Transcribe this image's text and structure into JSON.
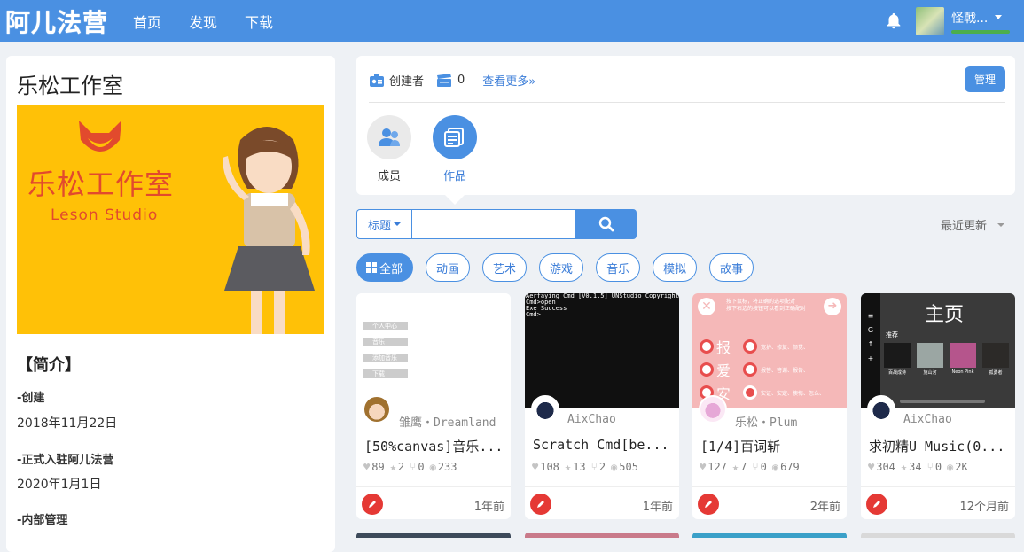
{
  "header": {
    "logo_text": "阿儿法营",
    "nav": [
      "首页",
      "发现",
      "下载"
    ],
    "username": "怪戟...",
    "bell_icon": "bell-icon"
  },
  "studio": {
    "title": "乐松工作室",
    "banner_cn": "乐松工作室",
    "banner_en": "Leson Studio",
    "intro_heading": "【简介】",
    "info": [
      {
        "label": "-创建",
        "value": "2018年11月22日"
      },
      {
        "label": "-正式入驻阿儿法营",
        "value": "2020年1月1日"
      },
      {
        "label": "-内部管理",
        "value": ""
      }
    ]
  },
  "creator_bar": {
    "creator_label": "创建者",
    "count": "0",
    "see_more": "查看更多»",
    "manage": "管理"
  },
  "tabs": [
    {
      "label": "成员",
      "icon": "members-icon"
    },
    {
      "label": "作品",
      "icon": "works-icon"
    }
  ],
  "search": {
    "select_label": "标题",
    "placeholder": "",
    "sort_label": "最近更新"
  },
  "filters": [
    "全部",
    "动画",
    "艺术",
    "游戏",
    "音乐",
    "模拟",
    "故事"
  ],
  "colors": {
    "primary": "#4a90e2",
    "badge": "#e53935"
  },
  "cards": [
    {
      "author": "雏鹰・Dreamland",
      "title": "[50%canvas]音乐...",
      "likes": "89",
      "stars": "2",
      "forks": "0",
      "views": "233",
      "time": "1年前",
      "thumb_menu": [
        "个人中心",
        "音乐",
        "添加音乐",
        "下载"
      ]
    },
    {
      "author": "AixChao",
      "title": "Scratch Cmd[be...",
      "likes": "108",
      "stars": "13",
      "forks": "2",
      "views": "505",
      "time": "1年前",
      "thumb_lines": [
        "Aerfaying Cmd [V0.1.5]  UNStudio Copyright",
        "Cmd>open",
        "Exe Success",
        "Cmd>"
      ]
    },
    {
      "author": "乐松・Plum",
      "title": "[1/4]百词斩",
      "likes": "127",
      "stars": "7",
      "forks": "0",
      "views": "679",
      "time": "2年前",
      "thumb_hint": [
        "按下鼠标，将正确的选项配对",
        "按下右边的按钮可以看到正确配对"
      ],
      "thumb_chars": [
        "报",
        "爱",
        "安"
      ],
      "thumb_options": [
        "宽护、修复、颜觉、",
        "报答、答谢、报告、",
        "安证、安定、懊悔、怎么、"
      ]
    },
    {
      "author": "AixChao",
      "title": "求初精U Music(0...",
      "likes": "304",
      "stars": "34",
      "forks": "0",
      "views": "2K",
      "time": "12个月前",
      "thumb_heading": "主页",
      "thumb_sub": "推荐",
      "thumb_tiles": [
        "百战成诗",
        "施山河",
        "Neon Pink",
        "孤勇者"
      ]
    }
  ]
}
